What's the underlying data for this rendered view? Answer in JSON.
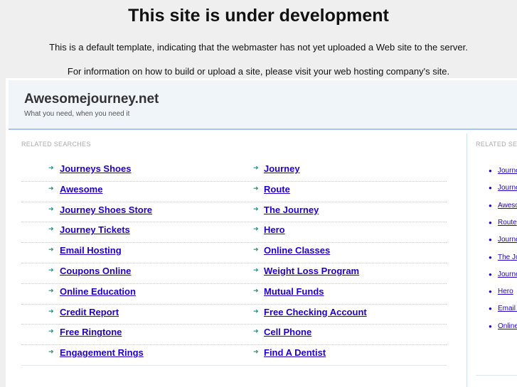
{
  "notice": {
    "title": "This site is under development",
    "line1": "This is a default template, indicating that the webmaster has not yet uploaded a Web site to the server.",
    "line2": "For information on how to build or upload a site, please visit your web hosting company's site."
  },
  "site": {
    "name": "Awesomejourney.net",
    "tagline": "What you need, when you need it"
  },
  "main": {
    "heading": "RELATED SEARCHES",
    "left": [
      "Journeys Shoes",
      "Awesome",
      "Journey Shoes Store",
      "Journey Tickets",
      "Email Hosting",
      "Coupons Online",
      "Online Education",
      "Credit Report",
      "Free Ringtone",
      "Engagement Rings"
    ],
    "right": [
      "Journey",
      "Route",
      "The Journey",
      "Hero",
      "Online Classes",
      "Weight Loss Program",
      "Mutual Funds",
      "Free Checking Account",
      "Cell Phone",
      "Find A Dentist"
    ]
  },
  "sidebar": {
    "heading": "RELATED SEARCHES",
    "items": [
      "Journeys Shoes",
      "Journey",
      "Awesome",
      "Route",
      "Journey Shoes Store",
      "The Journey",
      "Journey Tickets",
      "Hero",
      "Email Hosting",
      "Online Classes"
    ]
  }
}
